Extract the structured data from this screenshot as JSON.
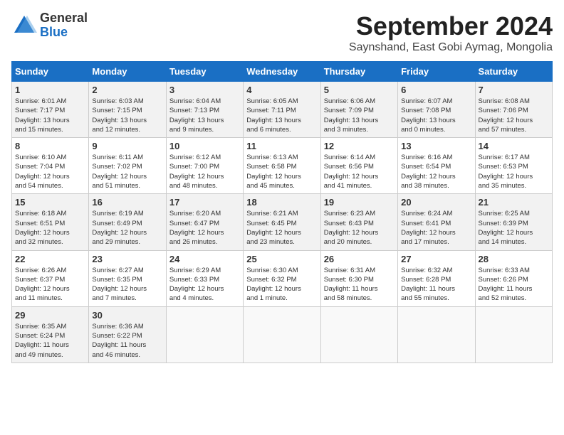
{
  "header": {
    "logo_general": "General",
    "logo_blue": "Blue",
    "title": "September 2024",
    "subtitle": "Saynshand, East Gobi Aymag, Mongolia"
  },
  "weekdays": [
    "Sunday",
    "Monday",
    "Tuesday",
    "Wednesday",
    "Thursday",
    "Friday",
    "Saturday"
  ],
  "weeks": [
    [
      {
        "day": "1",
        "info": "Sunrise: 6:01 AM\nSunset: 7:17 PM\nDaylight: 13 hours\nand 15 minutes."
      },
      {
        "day": "2",
        "info": "Sunrise: 6:03 AM\nSunset: 7:15 PM\nDaylight: 13 hours\nand 12 minutes."
      },
      {
        "day": "3",
        "info": "Sunrise: 6:04 AM\nSunset: 7:13 PM\nDaylight: 13 hours\nand 9 minutes."
      },
      {
        "day": "4",
        "info": "Sunrise: 6:05 AM\nSunset: 7:11 PM\nDaylight: 13 hours\nand 6 minutes."
      },
      {
        "day": "5",
        "info": "Sunrise: 6:06 AM\nSunset: 7:09 PM\nDaylight: 13 hours\nand 3 minutes."
      },
      {
        "day": "6",
        "info": "Sunrise: 6:07 AM\nSunset: 7:08 PM\nDaylight: 13 hours\nand 0 minutes."
      },
      {
        "day": "7",
        "info": "Sunrise: 6:08 AM\nSunset: 7:06 PM\nDaylight: 12 hours\nand 57 minutes."
      }
    ],
    [
      {
        "day": "8",
        "info": "Sunrise: 6:10 AM\nSunset: 7:04 PM\nDaylight: 12 hours\nand 54 minutes."
      },
      {
        "day": "9",
        "info": "Sunrise: 6:11 AM\nSunset: 7:02 PM\nDaylight: 12 hours\nand 51 minutes."
      },
      {
        "day": "10",
        "info": "Sunrise: 6:12 AM\nSunset: 7:00 PM\nDaylight: 12 hours\nand 48 minutes."
      },
      {
        "day": "11",
        "info": "Sunrise: 6:13 AM\nSunset: 6:58 PM\nDaylight: 12 hours\nand 45 minutes."
      },
      {
        "day": "12",
        "info": "Sunrise: 6:14 AM\nSunset: 6:56 PM\nDaylight: 12 hours\nand 41 minutes."
      },
      {
        "day": "13",
        "info": "Sunrise: 6:16 AM\nSunset: 6:54 PM\nDaylight: 12 hours\nand 38 minutes."
      },
      {
        "day": "14",
        "info": "Sunrise: 6:17 AM\nSunset: 6:53 PM\nDaylight: 12 hours\nand 35 minutes."
      }
    ],
    [
      {
        "day": "15",
        "info": "Sunrise: 6:18 AM\nSunset: 6:51 PM\nDaylight: 12 hours\nand 32 minutes."
      },
      {
        "day": "16",
        "info": "Sunrise: 6:19 AM\nSunset: 6:49 PM\nDaylight: 12 hours\nand 29 minutes."
      },
      {
        "day": "17",
        "info": "Sunrise: 6:20 AM\nSunset: 6:47 PM\nDaylight: 12 hours\nand 26 minutes."
      },
      {
        "day": "18",
        "info": "Sunrise: 6:21 AM\nSunset: 6:45 PM\nDaylight: 12 hours\nand 23 minutes."
      },
      {
        "day": "19",
        "info": "Sunrise: 6:23 AM\nSunset: 6:43 PM\nDaylight: 12 hours\nand 20 minutes."
      },
      {
        "day": "20",
        "info": "Sunrise: 6:24 AM\nSunset: 6:41 PM\nDaylight: 12 hours\nand 17 minutes."
      },
      {
        "day": "21",
        "info": "Sunrise: 6:25 AM\nSunset: 6:39 PM\nDaylight: 12 hours\nand 14 minutes."
      }
    ],
    [
      {
        "day": "22",
        "info": "Sunrise: 6:26 AM\nSunset: 6:37 PM\nDaylight: 12 hours\nand 11 minutes."
      },
      {
        "day": "23",
        "info": "Sunrise: 6:27 AM\nSunset: 6:35 PM\nDaylight: 12 hours\nand 7 minutes."
      },
      {
        "day": "24",
        "info": "Sunrise: 6:29 AM\nSunset: 6:33 PM\nDaylight: 12 hours\nand 4 minutes."
      },
      {
        "day": "25",
        "info": "Sunrise: 6:30 AM\nSunset: 6:32 PM\nDaylight: 12 hours\nand 1 minute."
      },
      {
        "day": "26",
        "info": "Sunrise: 6:31 AM\nSunset: 6:30 PM\nDaylight: 11 hours\nand 58 minutes."
      },
      {
        "day": "27",
        "info": "Sunrise: 6:32 AM\nSunset: 6:28 PM\nDaylight: 11 hours\nand 55 minutes."
      },
      {
        "day": "28",
        "info": "Sunrise: 6:33 AM\nSunset: 6:26 PM\nDaylight: 11 hours\nand 52 minutes."
      }
    ],
    [
      {
        "day": "29",
        "info": "Sunrise: 6:35 AM\nSunset: 6:24 PM\nDaylight: 11 hours\nand 49 minutes."
      },
      {
        "day": "30",
        "info": "Sunrise: 6:36 AM\nSunset: 6:22 PM\nDaylight: 11 hours\nand 46 minutes."
      },
      {
        "day": "",
        "info": ""
      },
      {
        "day": "",
        "info": ""
      },
      {
        "day": "",
        "info": ""
      },
      {
        "day": "",
        "info": ""
      },
      {
        "day": "",
        "info": ""
      }
    ]
  ]
}
